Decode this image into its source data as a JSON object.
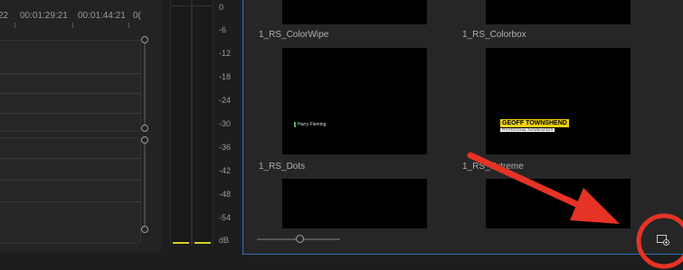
{
  "timeline": {
    "timecodes": [
      "22",
      "00:01:29:21",
      "00:01:44:21",
      "0("
    ]
  },
  "meter": {
    "db_labels": [
      "0",
      "-6",
      "-12",
      "-18",
      "-24",
      "-30",
      "-36",
      "-42",
      "-48",
      "-54",
      "dB"
    ]
  },
  "project": {
    "items": [
      {
        "label": "1_RS_ColorWipe"
      },
      {
        "label": "1_RS_Colorbox"
      },
      {
        "label": "1_RS_Dots",
        "preview_text": "Harry Fleming"
      },
      {
        "label": "1_RS_Extreme",
        "preview_title": "GEOFF TOWNSHEND",
        "preview_subtitle": "PROFESSIONAL SNOWBOARDER"
      }
    ],
    "new_item_icon": "new-item-icon"
  },
  "colors": {
    "panel_focus": "#2f6fb3",
    "annotation": "#e53326",
    "meter_level": "#d4cc2a",
    "title_yellow": "#f2d20c"
  }
}
